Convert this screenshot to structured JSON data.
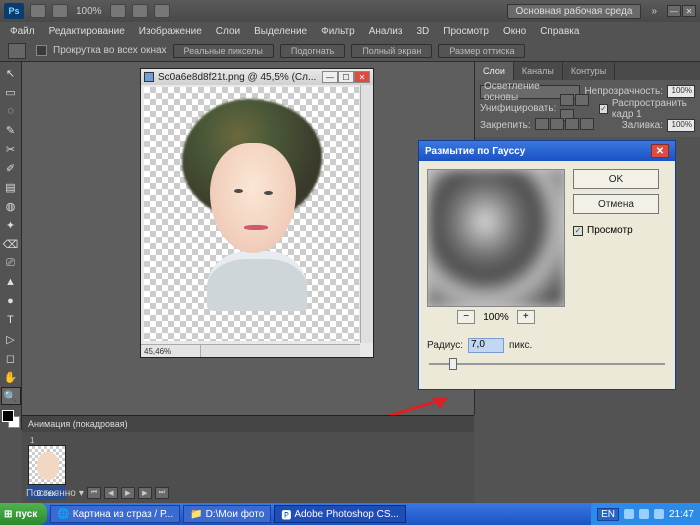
{
  "app": {
    "logo": "Ps",
    "zoom_pct": "100%",
    "workspace_btn": "Основная рабочая среда"
  },
  "menu": [
    "Файл",
    "Редактирование",
    "Изображение",
    "Слои",
    "Выделение",
    "Фильтр",
    "Анализ",
    "3D",
    "Просмотр",
    "Окно",
    "Справка"
  ],
  "options": {
    "scroll_all": "Прокрутка во всех окнах",
    "btns": [
      "Реальные пикселы",
      "Подогнать",
      "Полный экран",
      "Размер оттиска"
    ]
  },
  "document": {
    "title": "Sc0a6e8d8f21t.png @ 45,5% (Сл...",
    "status_zoom": "45,46%"
  },
  "layers_panel": {
    "tabs": [
      "Слои",
      "Каналы",
      "Контуры"
    ],
    "blend_mode": "Осветление основы",
    "opacity_label": "Непрозрачность:",
    "opacity_value": "100%",
    "unify_label": "Унифицировать:",
    "propagate_label": "Распространить кадр 1",
    "lock_label": "Закрепить:",
    "fill_label": "Заливка:",
    "fill_value": "100%"
  },
  "dialog": {
    "title": "Размытие по Гауссу",
    "ok": "OK",
    "cancel": "Отмена",
    "preview": "Просмотр",
    "zoom": "100%",
    "radius_label": "Радиус:",
    "radius_value": "7,0",
    "radius_unit": "пикс."
  },
  "animation": {
    "title": "Анимация (покадровая)",
    "frame1_num": "1",
    "frame1_time": "0 сек.",
    "loop": "Постоянно"
  },
  "taskbar": {
    "start": "пуск",
    "items": [
      "Картина из страз / Р...",
      "D:\\Мои фото",
      "Adobe Photoshop CS..."
    ],
    "lang": "EN",
    "time": "21:47"
  },
  "tools": [
    "↖",
    "▭",
    "◌",
    "✎",
    "✂",
    "✐",
    "▤",
    "◍",
    "✦",
    "⌫",
    "⎚",
    "▲",
    "●",
    "T",
    "▷",
    "◻",
    "✋",
    "🔍"
  ]
}
